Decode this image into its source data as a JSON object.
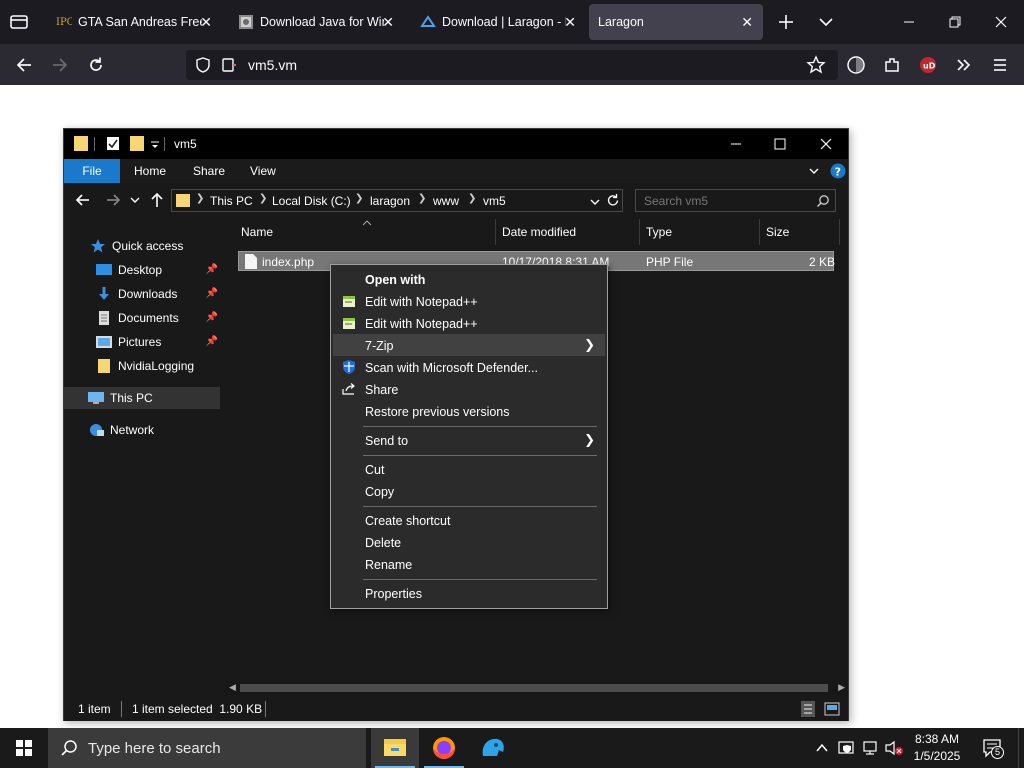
{
  "browser": {
    "tabs": [
      {
        "label": "GTA San Andreas Free D",
        "favicon": "ipc-favicon"
      },
      {
        "label": "Download Java for Win",
        "favicon": "java-favicon"
      },
      {
        "label": "Download | Laragon - P",
        "favicon": "laragon-favicon"
      },
      {
        "label": "Laragon",
        "favicon": "none"
      }
    ],
    "url": "vm5.vm",
    "tab_close_glyph": "✕"
  },
  "explorer": {
    "title": "vm5",
    "ribbon": {
      "file": "File",
      "home": "Home",
      "share": "Share",
      "view": "View"
    },
    "breadcrumbs": [
      "This PC",
      "Local Disk (C:)",
      "laragon",
      "www",
      "vm5"
    ],
    "search_placeholder": "Search vm5",
    "sidebar": [
      {
        "label": "Quick access",
        "icon": "star-icon"
      },
      {
        "label": "Desktop",
        "icon": "desktop-icon",
        "pinned": true
      },
      {
        "label": "Downloads",
        "icon": "download-icon",
        "pinned": true
      },
      {
        "label": "Documents",
        "icon": "document-icon",
        "pinned": true
      },
      {
        "label": "Pictures",
        "icon": "pictures-icon",
        "pinned": true
      },
      {
        "label": "NvidiaLogging",
        "icon": "folder-icon"
      },
      {
        "label": "This PC",
        "icon": "pc-icon"
      },
      {
        "label": "Network",
        "icon": "network-icon"
      }
    ],
    "columns": [
      "Name",
      "Date modified",
      "Type",
      "Size"
    ],
    "files": [
      {
        "name": "index.php",
        "date": "10/17/2018 8:31 AM",
        "type": "PHP File",
        "size": "2 KB"
      }
    ],
    "status": {
      "count": "1 item",
      "selected": "1 item selected  1.90 KB"
    }
  },
  "context_menu": {
    "open_with": "Open with",
    "edit_npp_1": "Edit with Notepad++",
    "edit_npp_2": "Edit with Notepad++",
    "zip": "7-Zip",
    "defender": "Scan with Microsoft Defender...",
    "share": "Share",
    "restore": "Restore previous versions",
    "send_to": "Send to",
    "cut": "Cut",
    "copy": "Copy",
    "create_shortcut": "Create shortcut",
    "delete": "Delete",
    "rename": "Rename",
    "properties": "Properties"
  },
  "taskbar": {
    "search_placeholder": "Type here to search",
    "time": "8:38 AM",
    "date": "1/5/2025",
    "notification_count": "5"
  },
  "colors": {
    "accent": "#1979ca",
    "taskbar_underline": "#76b9ed"
  }
}
